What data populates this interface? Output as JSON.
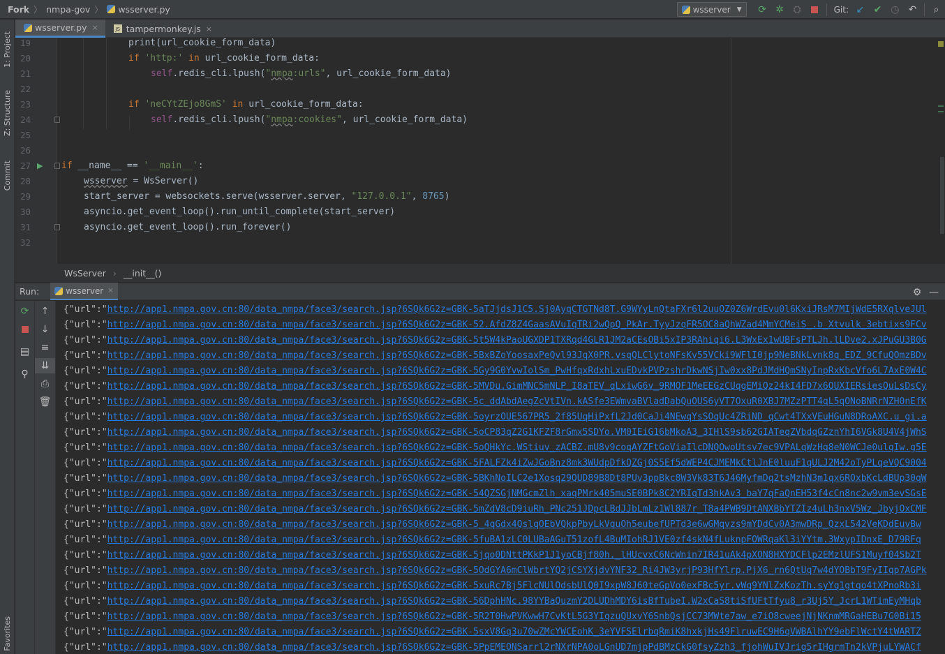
{
  "topbar": {
    "app": "Fork",
    "project": "nmpa-gov",
    "file": "wsserver.py",
    "run_config": "wsserver",
    "git_label": "Git:"
  },
  "left_strip": {
    "tabs": [
      "1: Project",
      "Z: Structure",
      "Commit",
      "Favorites"
    ]
  },
  "editor_tabs": [
    {
      "label": "wsserver.py",
      "active": true,
      "close": "×"
    },
    {
      "label": "tampermonkey.js",
      "active": false,
      "close": "×"
    }
  ],
  "editor": {
    "line_numbers": [
      "19",
      "20",
      "21",
      "22",
      "23",
      "24",
      "25",
      "26",
      "27",
      "28",
      "29",
      "30",
      "31",
      "32"
    ],
    "code": {
      "l19": {
        "fn": "print",
        "rest": "(url_cookie_form_data)"
      },
      "l20": {
        "kw": "if",
        "str": "'http:'",
        "kw2": "in",
        "rest": "url_cookie_form_data:"
      },
      "l21": {
        "self": "self",
        "a": ".redis_cli.lpush(",
        "q1": "\"",
        "w": "nmpa",
        "s": ":urls\"",
        "rest": ", url_cookie_form_data)"
      },
      "l23": {
        "kw": "if",
        "str": "'neCYtZEjo8GmS'",
        "kw2": "in",
        "rest": "url_cookie_form_data:"
      },
      "l24": {
        "self": "self",
        "a": ".redis_cli.lpush(",
        "q1": "\"",
        "w": "nmpa",
        "s": ":cookies\"",
        "rest": ", url_cookie_form_data)"
      },
      "l27": {
        "kw": "if",
        "a": " __name__ == ",
        "str": "'__main__'",
        "rest": ":"
      },
      "l28": {
        "w": "wsserver",
        "rest": " = WsServer()"
      },
      "l29": {
        "a": "start_server = websockets.serve(wsserver.server, ",
        "str": "\"127.0.0.1\"",
        "b": ", ",
        "num": "8765",
        "rest": ")"
      },
      "l30": {
        "a": "asyncio.get_event_loop().run_until_complete(start_server)"
      },
      "l31": {
        "a": "asyncio.get_event_loop().run_forever()"
      }
    }
  },
  "editor_breadcrumbs": [
    "WsServer",
    "__init__()"
  ],
  "run_panel": {
    "label": "Run:",
    "tab": "wsserver",
    "prefix": "{\"url\":\"",
    "lines": [
      "http://app1.nmpa.gov.cn:80/data_nmpa/face3/search.jsp?6SQk6G2z=GBK-5aTJjdsJ1C5.Sj0AyqCTGTNd8T.G9WYyLnQtaFXr6l2uuOZ0Z6WrdEvu0l6KxiJRsM7MIjWdE5RXqlveJUl",
      "http://app1.nmpa.gov.cn:80/data_nmpa/face3/search.jsp?6SQk6G2z=GBK-52.AfdZ8Z4GaasAVuIqTRi2wQpQ_PkAr.TyyJzqFR5OC8aQhWZad4MmYCMeiS_.b_Xtvulk_3ebtixs9FCv",
      "http://app1.nmpa.gov.cn:80/data_nmpa/face3/search.jsp?6SQk6G2z=GBK-5t5W4kPaoUGXDP1TXRqd4GLR1JM2aCEsOBi5xIP3RAhiqi6.L3WxEx1wUBFsPTLJh.lLDve2.xJPuGU3B0G",
      "http://app1.nmpa.gov.cn:80/data_nmpa/face3/search.jsp?6SQk6G2z=GBK-5BxBZoYoosaxPeQvl93JqX0PR.vsqQLClytoNFsKv55VCki9WFlI0jp9NeBNkLvnk8q_EDZ_9CfuQOmzBDv",
      "http://app1.nmpa.gov.cn:80/data_nmpa/face3/search.jsp?6SQk6G2z=GBK-5Gy9G0YvwIolSm_PwHfqxRdxhLxuEDvkPVPzshrDkwNSjIw0xx8PdJMdHQmSNyInpRxKbcVfo6L7AxE0W4C",
      "http://app1.nmpa.gov.cn:80/data_nmpa/face3/search.jsp?6SQk6G2z=GBK-5MVDu.GimMNC5mNLP_I8aTEV_qLxiwG6v_9RMOF1MeEEGzCUqgEMiQz24kI4FD7x6QUXIERsiesQuLsDsCy",
      "http://app1.nmpa.gov.cn:80/data_nmpa/face3/search.jsp?6SQk6G2z=GBK-5c_ddAbdAegZcVtIVn.kASfe3EWmvaBVladDabQuOUS6yVT7OxuR0XBJ7MZzPTT4qL5qONoBNRrNZH0nEfK",
      "http://app1.nmpa.gov.cn:80/data_nmpa/face3/search.jsp?6SQk6G2z=GBK-5oyrzOUE567PR5_2f85UqHiPxfL2Jd0CaJi4NEwqYsSOqUc4ZRiND_qCwt4TXxVEuHGuN8DRoAXC.u_gi.a",
      "http://app1.nmpa.gov.cn:80/data_nmpa/face3/search.jsp?6SQk6G2z=GBK-5oCP83qZ2G1KFZF8rGmx5SDYo.VM0IEiG16bMkoA3_3IHlS9sb62GIATeqZVbdqGZznYhI6VGk8U4V4jWhS",
      "http://app1.nmpa.gov.cn:80/data_nmpa/face3/search.jsp?6SQk6G2z=GBK-5oQHkYc.WStiuv_zACBZ.mU8v9coqAYZFtGoViaIlcDNQOwoUtsv7ec9VPALqWzHq8eN0WCJe0ulqIw.g5E",
      "http://app1.nmpa.gov.cn:80/data_nmpa/face3/search.jsp?6SQk6G2z=GBK-5FALFZk4iZwJGoBnz8mk3WUdpDfkQZGj0S5Ef5dWEP4CJMEMkCtlJnE0luuF1qULJ2M42oTyPLqeVQC9004",
      "http://app1.nmpa.gov.cn:80/data_nmpa/face3/search.jsp?6SQk6G2z=GBK-5BKhNoILC2e1Xosq29QUD89B8Dt8PUv3ppBkc8W3Vk83T6J46MyfmDq2tsMzhN3m1qx6ROxbKcLdBUp30qW",
      "http://app1.nmpa.gov.cn:80/data_nmpa/face3/search.jsp?6SQk6G2z=GBK-54QZSGjNMGcmZlh_xaqPMrk405muSE0BPk8C2YRIqTd3hkAv3_baY7qFaQnEH53f4cCn8nc2w9vm3evSGsE",
      "http://app1.nmpa.gov.cn:80/data_nmpa/face3/search.jsp?6SQk6G2z=GBK-5mZdV8cD9iuRh_PNc251JDpcLBdJJbLmLz1Wl887r_T8a4PWB9DtANXBbYTZIz4uLh3nxV5Wz_JbyjOxCMF",
      "http://app1.nmpa.gov.cn:80/data_nmpa/face3/search.jsp?6SQk6G2z=GBK-5_4qGdx4QslqOEbVQkpPbyLkVquOh5eubefUPTd3e6wGMqvzs9mYDdCv0A3mwDRp_QzxL542VeKDdEuvBw",
      "http://app1.nmpa.gov.cn:80/data_nmpa/face3/search.jsp?6SQk6G2z=GBK-5fuBA1zLC0LUBaAGuT51zofL4BuMIohRJ1VE0zf4skN4fLuknpFOWRqaKl3iYYtm.3WxypIDnxE_D79RFq",
      "http://app1.nmpa.gov.cn:80/data_nmpa/face3/search.jsp?6SQk6G2z=GBK-5jqo0DNttPKkP1J1yoCBjf80h._lHUcvxC6NcWnin7IR41uAk4pXON8HXYDCFlp2EMzlUFS1Muyf04Sb2T",
      "http://app1.nmpa.gov.cn:80/data_nmpa/face3/search.jsp?6SQk6G2z=GBK-5OdGYA6mClWbrtYQ2jCSYXjdvYNF32_Ri4JW3yrjP93HfYlrp.PjX6_rn6QtUq7w4dYOBbT9FyIIqp7AGPk",
      "http://app1.nmpa.gov.cn:80/data_nmpa/face3/search.jsp?6SQk6G2z=GBK-5xuRc7Bj5FlcNUlOdsbUlQ0I9xpW8J60teGpVo0exFBc5yr.vWq9YNlZxKozTh.syYq1gtqo4tXPnoRb3i",
      "http://app1.nmpa.gov.cn:80/data_nmpa/face3/search.jsp?6SQk6G2z=GBK-56DphHNc.98YYBaQuzmY2DLUDhMDY6isBfTubeI.W2xCaS8tiSfUFtTfyu8_r3Uj5Y_JcrL1WTimEyMHqb",
      "http://app1.nmpa.gov.cn:80/data_nmpa/face3/search.jsp?6SQk6G2z=GBK-5R2T0HwPVKwwH7CvKtL5G3YIqzuQUxvY6SnbQsjCC73MWte7aw_e7iO8cweejNjNKnmMRGaHEBu7G0Bi15",
      "http://app1.nmpa.gov.cn:80/data_nmpa/face3/search.jsp?6SQk6G2z=GBK-5sxV8Gq3u70wZMcYWCEohK_3eYVFSElrbqRmiK8hxkjHs49FlruwEC9H6qVWBAlhYY9ebFlWctY4tWARTZ",
      "http://app1.nmpa.gov.cn:80/data_nmpa/face3/search.jsp?6SQk6G2z=GBK-5PpEMEONSarrl2rNXrNPA0oLGnUD7mjpPdBMzCkG0fsyZzh3_fjohWuIVJrig5rIHgrmTn2kVPjuLYWACf"
    ]
  },
  "colors": {
    "background": "#2b2b2b",
    "link": "#287bde",
    "keyword": "#cc7832",
    "string": "#6a8759",
    "self": "#94558d",
    "number": "#6897bb",
    "accent": "#4a88c7"
  }
}
